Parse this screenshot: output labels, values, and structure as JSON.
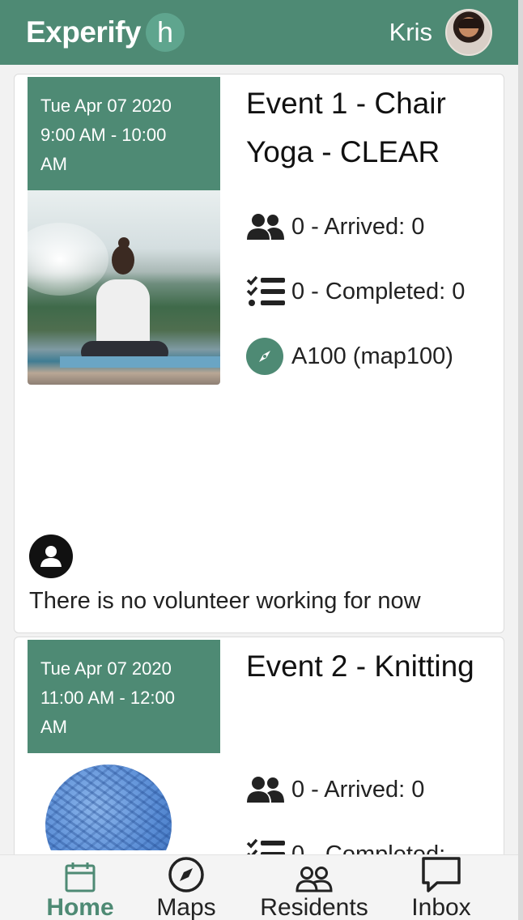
{
  "header": {
    "brand": "Experify",
    "brand_badge": "h",
    "user_name": "Kris"
  },
  "events": [
    {
      "date": "Tue Apr 07 2020",
      "time_line1": "9:00 AM - 10:00",
      "time_line2": "AM",
      "title": "Event 1 - Chair Yoga - CLEAR",
      "arrived": "0 - Arrived: 0",
      "completed": "0 - Completed: 0",
      "location": "A100 (map100)",
      "volunteer_text": "There is no volunteer working for now"
    },
    {
      "date": "Tue Apr 07 2020",
      "time_line1": "11:00 AM - 12:00",
      "time_line2": "AM",
      "title": "Event 2 - Knitting",
      "arrived": "0 - Arrived: 0",
      "completed": "0 - Completed:"
    }
  ],
  "nav": {
    "items": [
      {
        "label": "Home",
        "icon": "calendar-icon",
        "active": true
      },
      {
        "label": "Maps",
        "icon": "compass-icon",
        "active": false
      },
      {
        "label": "Residents",
        "icon": "people-icon",
        "active": false
      },
      {
        "label": "Inbox",
        "icon": "chat-icon",
        "active": false
      }
    ]
  },
  "colors": {
    "brand": "#4e8a74",
    "brand_light": "#5fa58e"
  }
}
